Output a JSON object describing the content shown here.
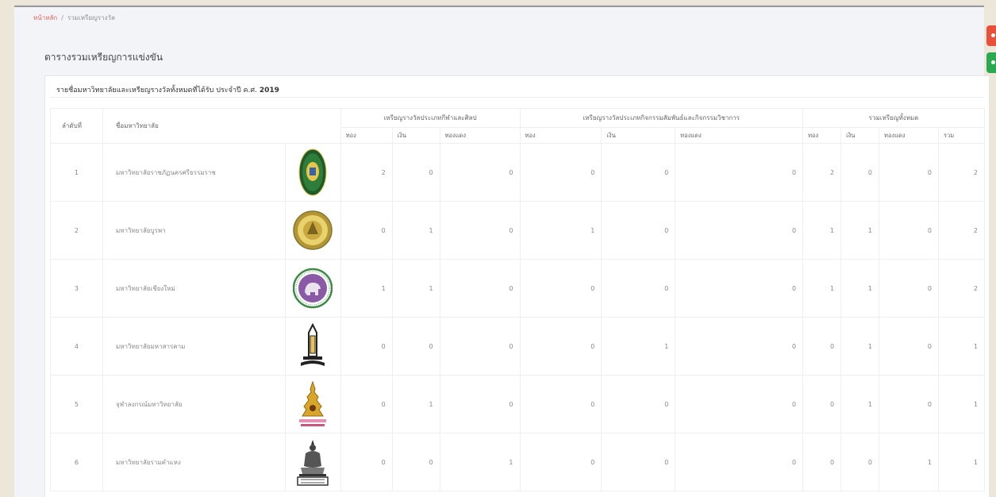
{
  "breadcrumb": {
    "home": "หน้าหลัก",
    "separator": "/",
    "current": "รวมเหรียญรางวัล"
  },
  "page_title": "ตารางรวมเหรียญการแข่งขัน",
  "card": {
    "title": "รายชื่อมหาวิทยาลัยและเหรียญรางวัลทั้งหมดที่ได้รับ ประจำปี ค.ศ.",
    "year": "2019"
  },
  "table": {
    "col_rank": "ลำดับที่",
    "col_name": "ชื่อมหาวิทยาลัย",
    "groups": [
      "เหรียญรางวัลประเภทกีฬาและศิลป",
      "เหรียญรางวัลประเภทกิจกรรมสัมพันธ์และกิจกรรมวิชาการ",
      "รวมเหรียญทั้งหมด"
    ],
    "sub": {
      "gold": "ทอง",
      "silver": "เงิน",
      "bronze": "ทองแดง",
      "total": "รวม"
    },
    "rows": [
      {
        "rank": "1",
        "name": "มหาวิทยาลัยราชภัฏนครศรีธรรมราช",
        "logo": "green-seal-logo",
        "v": [
          "2",
          "0",
          "0",
          "0",
          "0",
          "0",
          "2",
          "0",
          "0",
          "2"
        ]
      },
      {
        "rank": "2",
        "name": "มหาวิทยาลัยบูรพา",
        "logo": "gold-seal-logo",
        "v": [
          "0",
          "1",
          "0",
          "1",
          "0",
          "0",
          "1",
          "1",
          "0",
          "2"
        ]
      },
      {
        "rank": "3",
        "name": "มหาวิทยาลัยเชียงใหม่",
        "logo": "elephant-seal-logo",
        "v": [
          "1",
          "1",
          "0",
          "0",
          "0",
          "0",
          "1",
          "1",
          "0",
          "2"
        ]
      },
      {
        "rank": "4",
        "name": "มหาวิทยาลัยมหาสารคาม",
        "logo": "tower-emblem-logo",
        "v": [
          "0",
          "0",
          "0",
          "0",
          "1",
          "0",
          "0",
          "1",
          "0",
          "1"
        ]
      },
      {
        "rank": "5",
        "name": "จุฬาลงกรณ์มหาวิทยาลัย",
        "logo": "crown-emblem-logo",
        "v": [
          "0",
          "1",
          "0",
          "0",
          "0",
          "0",
          "0",
          "1",
          "0",
          "1"
        ]
      },
      {
        "rank": "6",
        "name": "มหาวิทยาลัยรามคำแหง",
        "logo": "seated-figure-logo",
        "v": [
          "0",
          "0",
          "1",
          "0",
          "0",
          "0",
          "0",
          "0",
          "1",
          "1"
        ]
      }
    ]
  },
  "colors": {
    "accent_red": "#e8503c",
    "accent_green": "#2aa950",
    "link": "#e2655a"
  }
}
